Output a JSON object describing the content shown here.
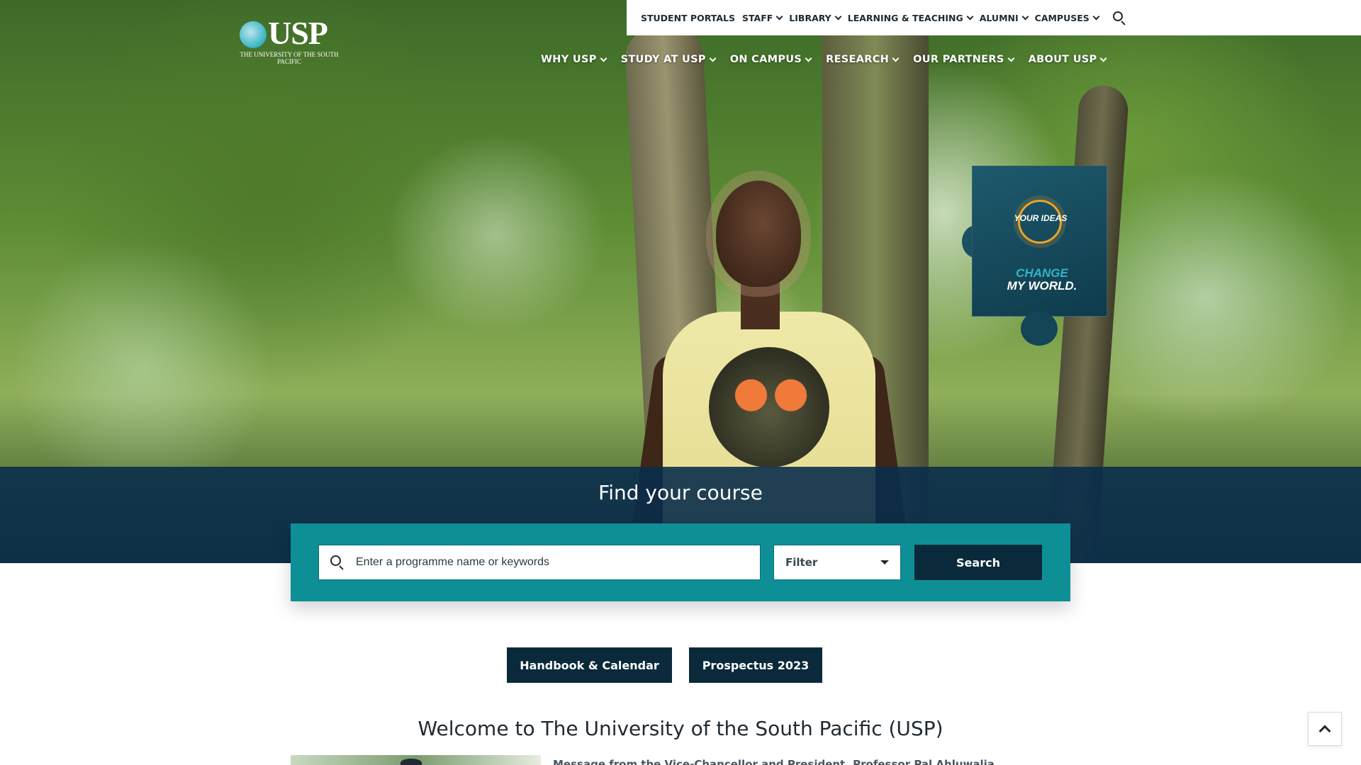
{
  "utility_nav": {
    "items": [
      {
        "label": "STUDENT PORTALS",
        "has_dropdown": false
      },
      {
        "label": "STAFF",
        "has_dropdown": true
      },
      {
        "label": "LIBRARY",
        "has_dropdown": true
      },
      {
        "label": "LEARNING & TEACHING",
        "has_dropdown": true
      },
      {
        "label": "ALUMNI",
        "has_dropdown": true
      },
      {
        "label": "CAMPUSES",
        "has_dropdown": true
      }
    ],
    "search_icon": "search-icon"
  },
  "logo": {
    "text": "USP",
    "subtitle": "THE UNIVERSITY OF THE SOUTH PACIFIC"
  },
  "main_nav": {
    "items": [
      {
        "label": "WHY USP"
      },
      {
        "label": "STUDY AT USP"
      },
      {
        "label": "ON CAMPUS"
      },
      {
        "label": "RESEARCH"
      },
      {
        "label": "OUR PARTNERS"
      },
      {
        "label": "ABOUT USP"
      }
    ]
  },
  "hero": {
    "badge": {
      "line1": "YOUR IDEAS",
      "line2": "CHANGE",
      "line3": "MY WORLD."
    }
  },
  "course_search": {
    "title": "Find your course",
    "placeholder": "Enter a programme name or keywords",
    "filter_label": "Filter",
    "search_label": "Search"
  },
  "actions": {
    "handbook_label": "Handbook & Calendar",
    "prospectus_label": "Prospectus 2023"
  },
  "welcome": {
    "title": "Welcome to The University of the South Pacific (USP)",
    "message": "Message from the Vice-Chancellor and President, Professor Pal Ahluwalia"
  },
  "colors": {
    "dark_navy": "#0a2a3b",
    "teal": "#0e8f96",
    "band_overlay": "#0a2d4b",
    "accent_cyan": "#34b3c6",
    "sun_orange": "#f0a227"
  }
}
